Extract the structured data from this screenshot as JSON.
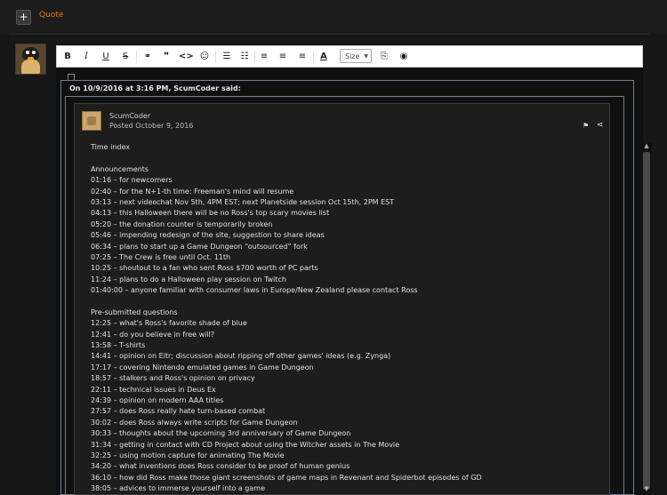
{
  "top": {
    "plus": "+",
    "quote_label": "Quote"
  },
  "toolbar": {
    "bold": "B",
    "italic": "I",
    "underline": "U",
    "strike": "S",
    "link": "⚭",
    "blockquote": "❞",
    "code": "<>",
    "emoji": "☺",
    "bullets": "☰",
    "numbers": "☷",
    "align_left": "≡",
    "align_center": "≡",
    "align_right": "≡",
    "text_color": "A",
    "size_label": "Size",
    "size_caret": "▼",
    "source": "⎘",
    "preview": "◉"
  },
  "quote": {
    "header": "On 10/9/2016 at 3:16 PM, ScumCoder said:"
  },
  "post": {
    "author": "ScumCoder",
    "posted": "Posted October 9, 2016",
    "flag_icon": "⚑",
    "share_icon": "⋖",
    "lines": [
      "Time index",
      "",
      "Announcements",
      "01:16 – for newcomers",
      "02:40 – for the N+1-th time: Freeman's mind will resume",
      "03:13 – next videochat Nov 5th, 4PM EST; next Planetside session Oct 15th, 2PM EST",
      "04:13 – this Halloween there will be no Ross's top scary movies list",
      "05:20 – the donation counter is temporarily broken",
      "05:46 – impending redesign of the site, suggestion to share ideas",
      "06:34 – plans to start up a Game Dungeon “outsourced” fork",
      "07:25 – The Crew is free until Oct. 11th",
      "10:25 – shoutout to a fan who sent Ross $700 worth of PC parts",
      "11:24 – plans to do a Halloween play session on Twitch",
      "01:40:00 – anyone familiar with consumer laws in Europe/New Zealand please contact Ross",
      "",
      "Pre-submitted questions",
      "12:25 – what's Ross's favorite shade of blue",
      "12:41 – do you believe in free will?",
      "13:58 – T-shirts",
      "14:41 – opinion on Eitr; discussion about ripping off other games' ideas (e.g. Zynga)",
      "17:17 – covering Nintendo emulated games in Game Dungeon",
      "18:57 – stalkers and Ross's opinion on privacy",
      "22:11 – technical issues in Deus Ex",
      "24:39 – opinion on modern AAA titles",
      "27:57 – does Ross really hate turn-based combat",
      "30:02 – does Ross always write scripts for Game Dungeon",
      "30:33 – thoughts about the upcoming 3rd anniversary of Game Dungeon",
      "31:34 – getting in contact with CD Project about using the Witcher assets in The Movie",
      "32:25 – using motion capture for animating The Movie",
      "34:20 – what inventions does Ross consider to be proof of human genius",
      "36:10 – how did Ross make those giant screenshots of game maps in Revenant and Spiderbot episodes of GD",
      "38:05 – advices to immerse yourself into a game"
    ]
  },
  "scrollbar": {
    "up": "▲",
    "down": "▼"
  }
}
